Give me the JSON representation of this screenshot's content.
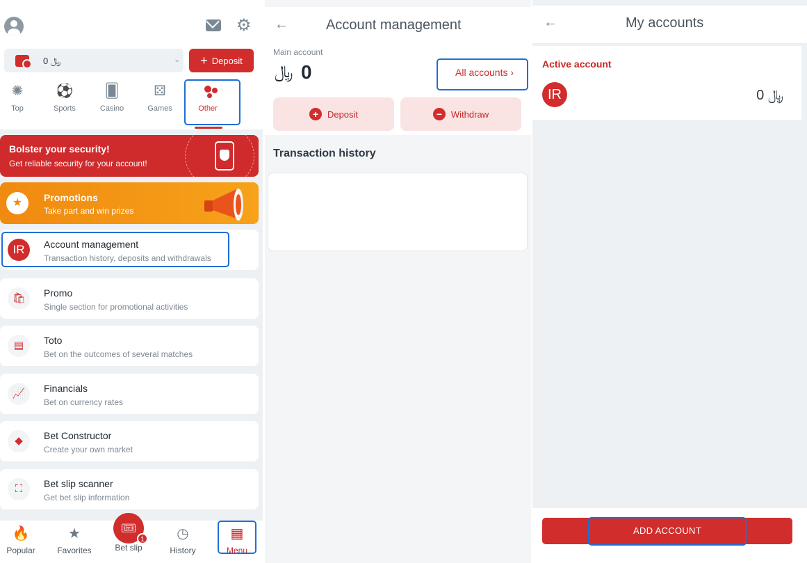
{
  "panel1": {
    "balance": {
      "value": "0 ﷼"
    },
    "deposit_label": "Deposit",
    "categories": [
      {
        "label": "Top",
        "icon": "gear-like-top-icon"
      },
      {
        "label": "Sports",
        "icon": "soccer-ball-icon"
      },
      {
        "label": "Casino",
        "icon": "cards-icon"
      },
      {
        "label": "Games",
        "icon": "dice-icon"
      },
      {
        "label": "Other",
        "icon": "dots-icon",
        "active": true
      }
    ],
    "security_banner": {
      "title": "Bolster your security!",
      "subtitle": "Get reliable security for your account!"
    },
    "promotions_banner": {
      "title": "Promotions",
      "subtitle": "Take part and win prizes"
    },
    "menu_items": [
      {
        "icon_text": "IR",
        "title": "Account management",
        "subtitle": "Transaction history, deposits and withdrawals"
      },
      {
        "icon_text": "",
        "title": "Promo",
        "subtitle": "Single section for promotional activities"
      },
      {
        "icon_text": "",
        "title": "Toto",
        "subtitle": "Bet on the outcomes of several matches"
      },
      {
        "icon_text": "",
        "title": "Financials",
        "subtitle": "Bet on currency rates"
      },
      {
        "icon_text": "",
        "title": "Bet Constructor",
        "subtitle": "Create your own market"
      },
      {
        "icon_text": "",
        "title": "Bet slip scanner",
        "subtitle": "Get bet slip information"
      }
    ],
    "bottom_nav": [
      {
        "label": "Popular"
      },
      {
        "label": "Favorites"
      },
      {
        "label": "Bet slip",
        "badge": "1"
      },
      {
        "label": "History"
      },
      {
        "label": "Menu",
        "active": true
      }
    ]
  },
  "panel2": {
    "title": "Account management",
    "main_account_label": "Main account",
    "balance_amount": "0",
    "balance_currency": "﷼",
    "all_accounts_label": "All accounts ›",
    "deposit_label": "Deposit",
    "withdraw_label": "Withdraw",
    "transaction_history_title": "Transaction history"
  },
  "panel3": {
    "title": "My accounts",
    "active_account_label": "Active account",
    "account_avatar": "IR",
    "account_balance": "0 ﷼",
    "add_account_label": "ADD ACCOUNT"
  },
  "colors": {
    "brand_red": "#d12d2d",
    "promo_orange": "#f08a10",
    "highlight_blue": "#1f6fd6"
  }
}
